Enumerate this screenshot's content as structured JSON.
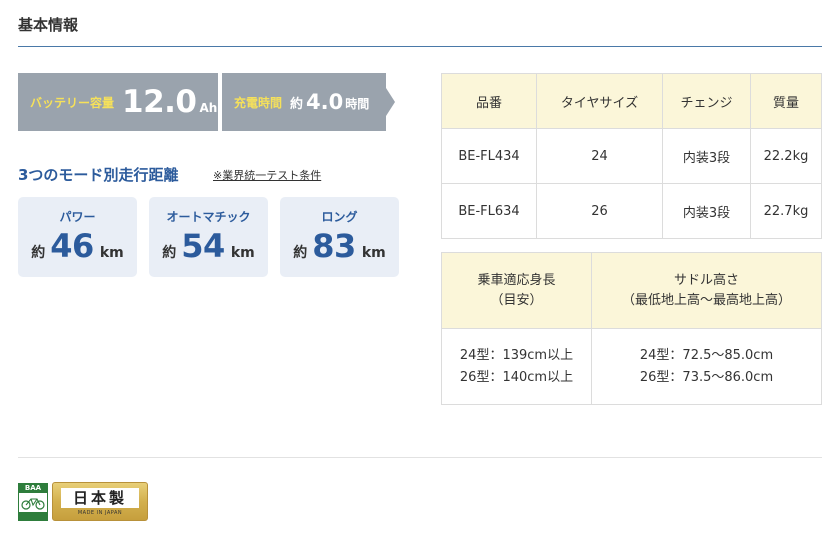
{
  "section_title": "基本情報",
  "specs": {
    "battery_label": "バッテリー容量",
    "battery_value": "12.0",
    "battery_unit": "Ah",
    "charge_label": "充電時間",
    "charge_prefix": "約",
    "charge_value": "4.0",
    "charge_unit": "時間"
  },
  "modes": {
    "heading": "3つのモード別走行距離",
    "note": "※業界統一テスト条件",
    "items": [
      {
        "name": "パワー",
        "prefix": "約",
        "value": "46",
        "unit": "km"
      },
      {
        "name": "オートマチック",
        "prefix": "約",
        "value": "54",
        "unit": "km"
      },
      {
        "name": "ロング",
        "prefix": "約",
        "value": "83",
        "unit": "km"
      }
    ]
  },
  "product_table": {
    "headers": [
      "品番",
      "タイヤサイズ",
      "チェンジ",
      "質量"
    ],
    "rows": [
      [
        "BE-FL434",
        "24",
        "内装3段",
        "22.2kg"
      ],
      [
        "BE-FL634",
        "26",
        "内装3段",
        "22.7kg"
      ]
    ]
  },
  "size_table": {
    "header_height_line1": "乗車適応身長",
    "header_height_line2": "（目安）",
    "header_saddle_line1": "サドル高さ",
    "header_saddle_line2": "（最低地上高〜最高地上高）",
    "height_24": "24型：139cm以上",
    "height_26": "26型：140cm以上",
    "saddle_24": "24型：72.5〜85.0cm",
    "saddle_26": "26型：73.5〜86.0cm"
  },
  "badges": {
    "baa": "BAA",
    "made_in_japan": "日本製",
    "made_in_japan_sub": "MADE IN JAPAN"
  }
}
